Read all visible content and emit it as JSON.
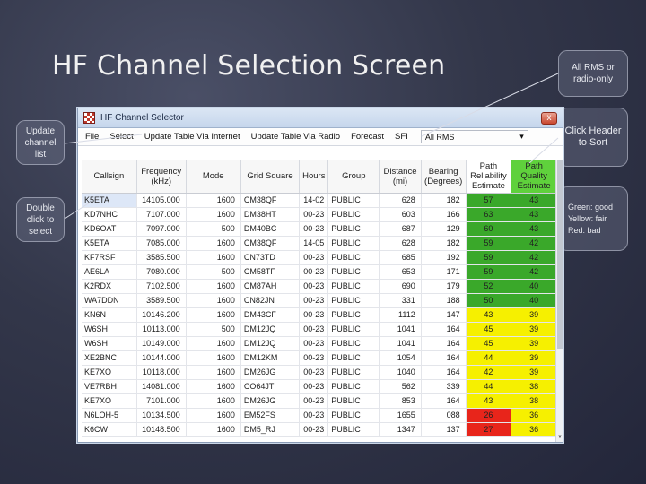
{
  "slide": {
    "title": "HF Channel Selection Screen",
    "callouts": {
      "update": "Update channel list",
      "dblclick": "Double click to select",
      "rms": "All RMS or radio-only",
      "sort": "Click Header to Sort",
      "colors": "Green: good Yellow: fair Red: bad"
    }
  },
  "window": {
    "title": "HF Channel Selector",
    "close_label": "x"
  },
  "menu": {
    "file": "File",
    "select": "Select",
    "update_internet": "Update Table Via Internet",
    "update_radio": "Update Table Via Radio",
    "forecast": "Forecast",
    "sfi": "SFI",
    "filter_value": "All RMS",
    "filter_arrow": "▾"
  },
  "table": {
    "columns": [
      "Callsign",
      "Frequency (kHz)",
      "Mode",
      "Grid Square",
      "Hours",
      "Group",
      "Distance (mi)",
      "Bearing (Degrees)",
      "Path Reliability Estimate",
      "Path Quality Estimate"
    ],
    "rows": [
      [
        "K5ETA",
        "14105.000",
        "1600",
        "CM38QF",
        "14-02",
        "PUBLIC",
        "628",
        "182",
        "57",
        "43"
      ],
      [
        "KD7NHC",
        "7107.000",
        "1600",
        "DM38HT",
        "00-23",
        "PUBLIC",
        "603",
        "166",
        "63",
        "43"
      ],
      [
        "KD6OAT",
        "7097.000",
        "500",
        "DM40BC",
        "00-23",
        "PUBLIC",
        "687",
        "129",
        "60",
        "43"
      ],
      [
        "K5ETA",
        "7085.000",
        "1600",
        "CM38QF",
        "14-05",
        "PUBLIC",
        "628",
        "182",
        "59",
        "42"
      ],
      [
        "KF7RSF",
        "3585.500",
        "1600",
        "CN73TD",
        "00-23",
        "PUBLIC",
        "685",
        "192",
        "59",
        "42"
      ],
      [
        "AE6LA",
        "7080.000",
        "500",
        "CM58TF",
        "00-23",
        "PUBLIC",
        "653",
        "171",
        "59",
        "42"
      ],
      [
        "K2RDX",
        "7102.500",
        "1600",
        "CM87AH",
        "00-23",
        "PUBLIC",
        "690",
        "179",
        "52",
        "40"
      ],
      [
        "WA7DDN",
        "3589.500",
        "1600",
        "CN82JN",
        "00-23",
        "PUBLIC",
        "331",
        "188",
        "50",
        "40"
      ],
      [
        "KN6N",
        "10146.200",
        "1600",
        "DM43CF",
        "00-23",
        "PUBLIC",
        "1112",
        "147",
        "43",
        "39"
      ],
      [
        "W6SH",
        "10113.000",
        "500",
        "DM12JQ",
        "00-23",
        "PUBLIC",
        "1041",
        "164",
        "45",
        "39"
      ],
      [
        "W6SH",
        "10149.000",
        "1600",
        "DM12JQ",
        "00-23",
        "PUBLIC",
        "1041",
        "164",
        "45",
        "39"
      ],
      [
        "XE2BNC",
        "10144.000",
        "1600",
        "DM12KM",
        "00-23",
        "PUBLIC",
        "1054",
        "164",
        "44",
        "39"
      ],
      [
        "KE7XO",
        "10118.000",
        "1600",
        "DM26JG",
        "00-23",
        "PUBLIC",
        "1040",
        "164",
        "42",
        "39"
      ],
      [
        "VE7RBH",
        "14081.000",
        "1600",
        "CO64JT",
        "00-23",
        "PUBLIC",
        "562",
        "339",
        "44",
        "38"
      ],
      [
        "KE7XO",
        "7101.000",
        "1600",
        "DM26JG",
        "00-23",
        "PUBLIC",
        "853",
        "164",
        "43",
        "38"
      ],
      [
        "N6LOH-5",
        "10134.500",
        "1600",
        "EM52FS",
        "00-23",
        "PUBLIC",
        "1655",
        "088",
        "26",
        "36"
      ],
      [
        "K6CW",
        "10148.500",
        "1600",
        "DM5_RJ",
        "00-23",
        "PUBLIC",
        "1347",
        "137",
        "27",
        "36"
      ]
    ],
    "rel_colors": [
      "green",
      "green",
      "green",
      "green",
      "green",
      "green",
      "green",
      "green",
      "yellow",
      "yellow",
      "yellow",
      "yellow",
      "yellow",
      "yellow",
      "yellow",
      "red",
      "red"
    ],
    "qual_colors": [
      "green",
      "green",
      "green",
      "green",
      "green",
      "green",
      "green",
      "green",
      "yellow",
      "yellow",
      "yellow",
      "yellow",
      "yellow",
      "yellow",
      "yellow",
      "yellow",
      "yellow"
    ],
    "color_map": {
      "green": "#3aa82a",
      "yellow": "#f6f000",
      "red": "#e8251b"
    },
    "selected_row": 0
  }
}
